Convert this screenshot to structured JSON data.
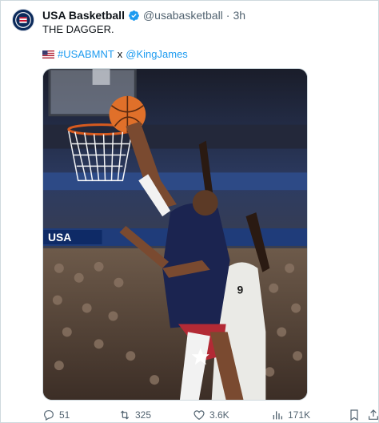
{
  "account": {
    "name": "USA Basketball",
    "handle": "@usabasketball",
    "separator": "·",
    "time": "3h",
    "verified": true
  },
  "tweet": {
    "text": "THE DAGGER.",
    "hashtag": "#USABMNT",
    "joiner": "x",
    "mention": "@KingJames",
    "flag_icon": "us-flag-icon"
  },
  "media": {
    "kind": "photo",
    "overlay_text": "USA"
  },
  "actions": {
    "replies": "51",
    "retweets": "325",
    "likes": "3.6K",
    "views": "171K"
  },
  "colors": {
    "link": "#1d9bf0",
    "secondary_text": "#536471",
    "primary_text": "#0f1419",
    "verified_badge": "#1d9bf0"
  }
}
